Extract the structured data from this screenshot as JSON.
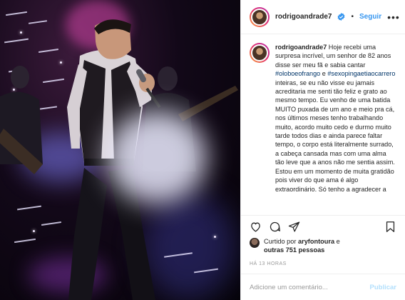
{
  "post": {
    "author": {
      "username": "rodrigoandrade7",
      "verified_icon": "verified-badge-icon",
      "separator": "•",
      "follow_label": "Seguir"
    },
    "caption": {
      "username": "rodrigoandrade7",
      "text_1": " Hoje recebi uma surpresa incrível, um senhor de 82 anos disse ser meu fã e sabia cantar ",
      "tag_1": "#oloboeofrango",
      "text_2": " e ",
      "tag_2": "#sexopingaetiaocarrero",
      "text_3": " inteiras, se eu não visse eu jamais acreditaria me senti tão feliz e grato ao mesmo tempo. Eu venho de uma batida MUITO puxada de um ano e meio pra cá, nos últimos meses tenho trabalhando muito, acordo muito cedo e durmo muito tarde todos dias e ainda parece faltar tempo, o corpo está literalmente surrado, a cabeça cansada mas com uma alma tão leve que a anos não me sentia assim. Estou em um momento de muita gratidão pois viver do que ama é algo extraordinário. Só tenho a agradecer a"
    },
    "likes": {
      "prefix": "Curtido por ",
      "user": "aryfontoura",
      "middle": " e",
      "others": "outras 751 pessoas"
    },
    "timestamp": "HÁ 13 HORAS",
    "comment_input": {
      "placeholder": "Adicione um comentário...",
      "value": "",
      "publish_label": "Publicar"
    },
    "icons": {
      "like": "heart-icon",
      "comment": "comment-icon",
      "share": "share-icon",
      "save": "bookmark-icon",
      "more": "more-options-icon"
    }
  },
  "colors": {
    "link_blue": "#3897f0",
    "hashtag": "#003569",
    "publish_disabled": "#b2dffc",
    "muted": "#999999",
    "text": "#262626"
  }
}
